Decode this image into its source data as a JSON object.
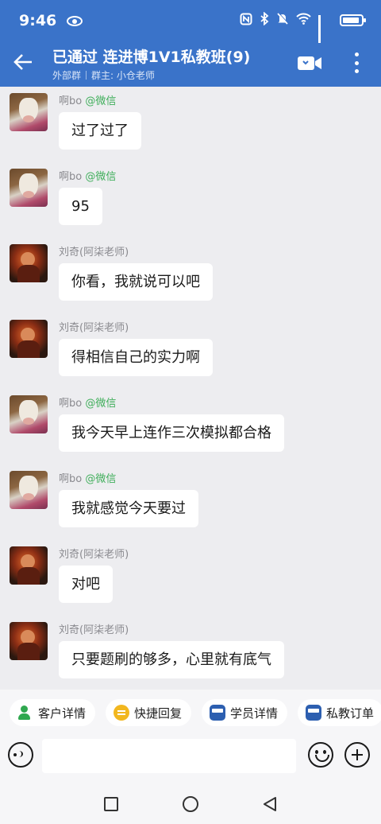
{
  "status_bar": {
    "time": "9:46",
    "icons": [
      "eye-icon",
      "nfc-icon",
      "bluetooth-icon",
      "mute-icon",
      "wifi-icon",
      "signal-icon",
      "battery-icon"
    ]
  },
  "header": {
    "title": "已通过 连进博1V1私教班(9)",
    "group_type": "外部群",
    "owner": "群主: 小仓老师",
    "accent_color": "#3a73c9"
  },
  "messages": [
    {
      "sender": "啊bo",
      "tag": "@微信",
      "text": "过了过了",
      "avatar": "cow-avatar"
    },
    {
      "sender": "啊bo",
      "tag": "@微信",
      "text": "95",
      "avatar": "cow-avatar"
    },
    {
      "sender": "刘奇(阿柒老师)",
      "tag": "",
      "text": "你看，我就说可以吧",
      "avatar": "hero-avatar"
    },
    {
      "sender": "刘奇(阿柒老师)",
      "tag": "",
      "text": "得相信自己的实力啊",
      "avatar": "hero-avatar"
    },
    {
      "sender": "啊bo",
      "tag": "@微信",
      "text": "我今天早上连作三次模拟都合格",
      "avatar": "cow-avatar"
    },
    {
      "sender": "啊bo",
      "tag": "@微信",
      "text": "我就感觉今天要过",
      "avatar": "cow-avatar"
    },
    {
      "sender": "刘奇(阿柒老师)",
      "tag": "",
      "text": "对吧",
      "avatar": "hero-avatar"
    },
    {
      "sender": "刘奇(阿柒老师)",
      "tag": "",
      "text": "只要题刷的够多，心里就有底气",
      "avatar": "hero-avatar"
    }
  ],
  "quick_actions": [
    {
      "label": "客户详情",
      "icon": "customer-icon"
    },
    {
      "label": "快捷回复",
      "icon": "quick-reply-icon"
    },
    {
      "label": "学员详情",
      "icon": "student-icon"
    },
    {
      "label": "私教订单",
      "icon": "order-icon"
    }
  ],
  "input": {
    "value": "",
    "placeholder": ""
  },
  "tag_color": "#3fae5a"
}
